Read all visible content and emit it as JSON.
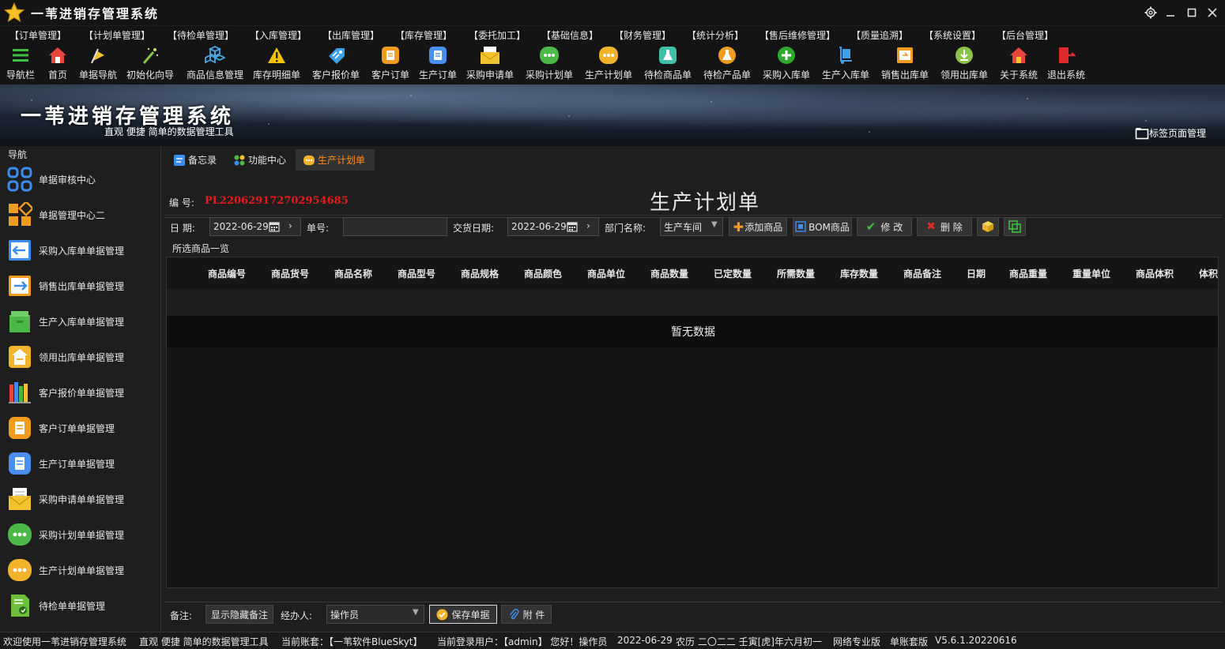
{
  "app": {
    "title": "一苇进销存管理系统"
  },
  "menu": [
    "【订单管理】",
    "【计划单管理】",
    "【待检单管理】",
    "【入库管理】",
    "【出库管理】",
    "【库存管理】",
    "【委托加工】",
    "【基础信息】",
    "【财务管理】",
    "【统计分析】",
    "【售后维修管理】",
    "【质量追溯】",
    "【系统设置】",
    "【后台管理】"
  ],
  "toolbar": [
    "导航栏",
    "首页",
    "单据导航",
    "初始化向导",
    "商品信息管理",
    "库存明细单",
    "客户报价单",
    "客户订单",
    "生产订单",
    "采购申请单",
    "采购计划单",
    "生产计划单",
    "待检商品单",
    "待检产品单",
    "采购入库单",
    "生产入库单",
    "销售出库单",
    "领用出库单",
    "关于系统",
    "退出系统"
  ],
  "banner": {
    "title": "一苇进销存管理系统",
    "subtitle": "直观 便捷 简单的数据管理工具",
    "tab_manage": "标签页面管理"
  },
  "nav": {
    "title": "导航",
    "items": [
      "单据审核中心",
      "单据管理中心二",
      "采购入库单单据管理",
      "销售出库单单据管理",
      "生产入库单单据管理",
      "领用出库单单据管理",
      "客户报价单单据管理",
      "客户订单单据管理",
      "生产订单单据管理",
      "采购申请单单据管理",
      "采购计划单单据管理",
      "生产计划单单据管理",
      "待检单单据管理"
    ]
  },
  "tabs": [
    "备忘录",
    "功能中心",
    "生产计划单"
  ],
  "form": {
    "code_label": "编 号:",
    "code_value": "PL220629172702954685",
    "doc_title": "生产计划单",
    "date_label": "日 期:",
    "date_value": "2022-06-29",
    "no_label": "单号:",
    "no_value": "",
    "delivery_label": "交货日期:",
    "delivery_value": "2022-06-29",
    "dept_label": "部门名称:",
    "dept_value": "生产车间",
    "btn_add": "添加商品",
    "btn_bom": "BOM商品",
    "btn_edit": "修 改",
    "btn_delete": "删 除",
    "group_title": "所选商品一览",
    "columns": [
      "商品编号",
      "商品货号",
      "商品名称",
      "商品型号",
      "商品规格",
      "商品颜色",
      "商品单位",
      "商品数量",
      "已定数量",
      "所需数量",
      "库存数量",
      "商品备注",
      "日期",
      "商品重量",
      "重量单位",
      "商品体积",
      "体积"
    ],
    "empty": "暂无数据",
    "remark_label": "备注:",
    "btn_toggle_remark": "显示隐藏备注",
    "handler_label": "经办人:",
    "handler_value": "操作员",
    "btn_save": "保存单据",
    "btn_attach": "附 件"
  },
  "status": {
    "welcome": "欢迎使用一苇进销存管理系统",
    "slogan": "直观 便捷 简单的数据管理工具",
    "account": "当前账套：【一苇软件BlueSkyt】",
    "user": "当前登录用户：【admin】 您好！操作员",
    "date": "2022-06-29",
    "lunar": "农历 二〇二二 壬寅[虎]年六月初一",
    "edition": "网络专业版",
    "mode": "单账套版",
    "version": "V5.6.1.20220616"
  },
  "colors": {
    "accent": "#ff8c1a",
    "code": "#e81b1b",
    "bg": "#1e1e1e"
  }
}
